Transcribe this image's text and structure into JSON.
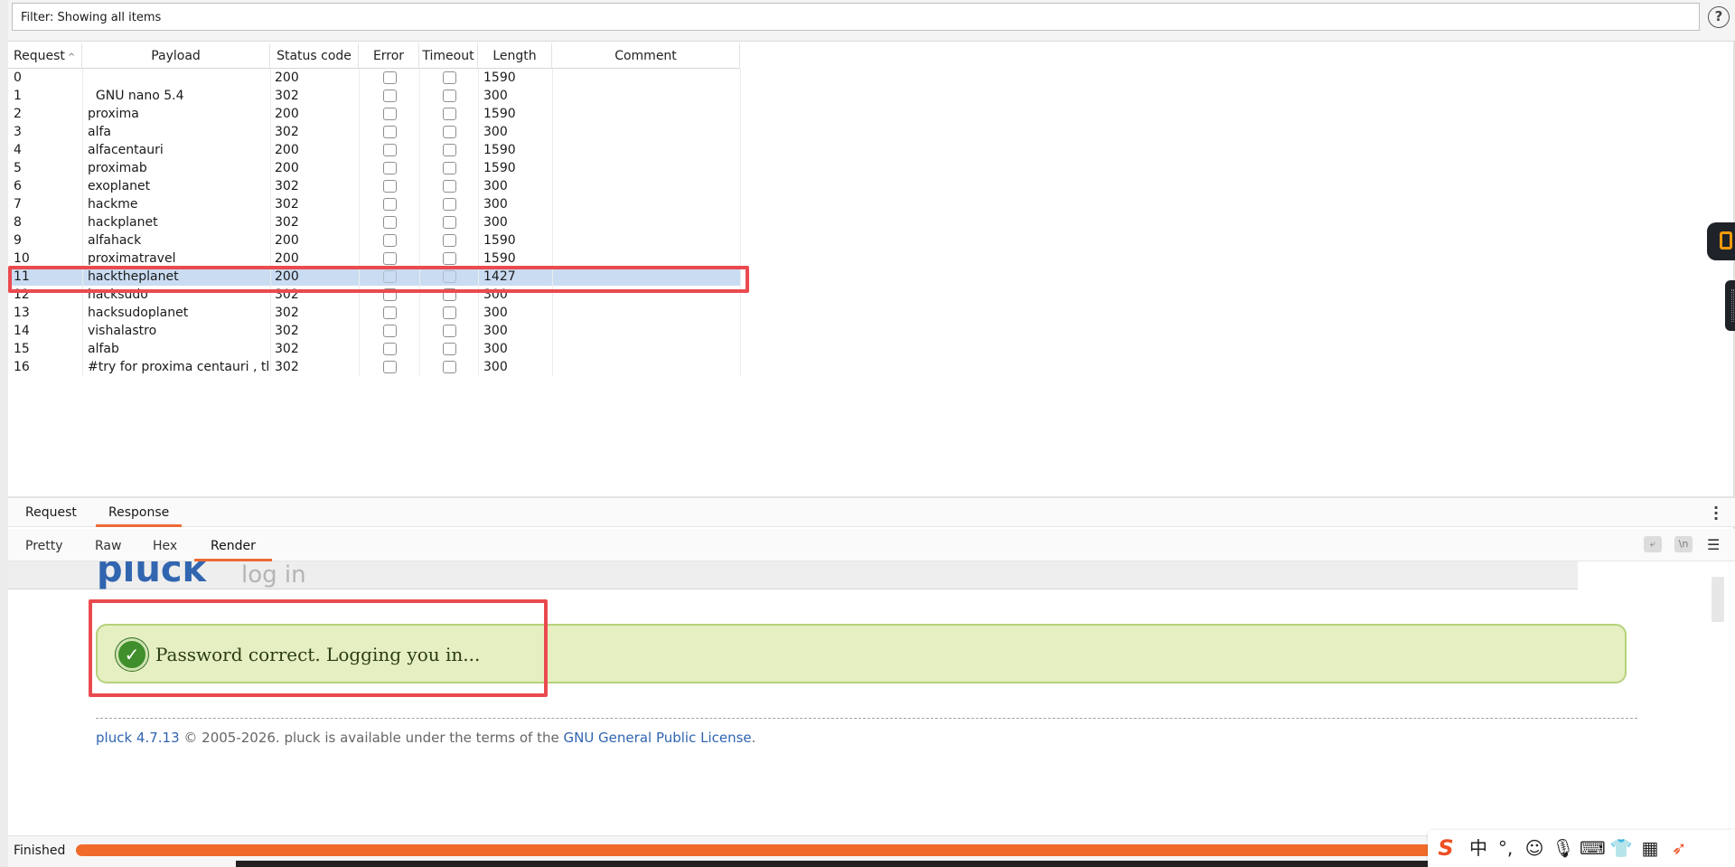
{
  "filter": {
    "text": "Filter: Showing all items",
    "help": "?"
  },
  "table": {
    "headers": {
      "request": "Request",
      "payload": "Payload",
      "status": "Status code",
      "error": "Error",
      "timeout": "Timeout",
      "length": "Length",
      "comment": "Comment"
    },
    "rows": [
      {
        "request": "0",
        "payload": "",
        "status": "200",
        "length": "1590"
      },
      {
        "request": "1",
        "payload": "  GNU nano 5.4",
        "status": "302",
        "length": "300"
      },
      {
        "request": "2",
        "payload": "proxima",
        "status": "200",
        "length": "1590"
      },
      {
        "request": "3",
        "payload": "alfa",
        "status": "302",
        "length": "300"
      },
      {
        "request": "4",
        "payload": "alfacentauri",
        "status": "200",
        "length": "1590"
      },
      {
        "request": "5",
        "payload": "proximab",
        "status": "200",
        "length": "1590"
      },
      {
        "request": "6",
        "payload": "exoplanet",
        "status": "302",
        "length": "300"
      },
      {
        "request": "7",
        "payload": "hackme",
        "status": "302",
        "length": "300"
      },
      {
        "request": "8",
        "payload": "hackplanet",
        "status": "302",
        "length": "300"
      },
      {
        "request": "9",
        "payload": "alfahack",
        "status": "200",
        "length": "1590"
      },
      {
        "request": "10",
        "payload": "proximatravel",
        "status": "200",
        "length": "1590"
      },
      {
        "request": "11",
        "payload": "hacktheplanet",
        "status": "200",
        "length": "1427"
      },
      {
        "request": "12",
        "payload": "hacksudo",
        "status": "302",
        "length": "300"
      },
      {
        "request": "13",
        "payload": "hacksudoplanet",
        "status": "302",
        "length": "300"
      },
      {
        "request": "14",
        "payload": "vishalastro",
        "status": "302",
        "length": "300"
      },
      {
        "request": "15",
        "payload": "alfab",
        "status": "302",
        "length": "300"
      },
      {
        "request": "16",
        "payload": "#try for proxima centauri , th...",
        "status": "302",
        "length": "300"
      }
    ]
  },
  "tabs": {
    "request": "Request",
    "response": "Response"
  },
  "subtabs": {
    "pretty": "Pretty",
    "raw": "Raw",
    "hex": "Hex",
    "render": "Render"
  },
  "render": {
    "logo": "pluck",
    "login": "log in",
    "success": "Password correct. Logging you in...",
    "footer_link1": "pluck 4.7.13",
    "footer_mid": " © 2005-2026. pluck is available under the terms of the ",
    "footer_link2": "GNU General Public License",
    "footer_end": "."
  },
  "status": {
    "text": "Finished"
  },
  "ime": {
    "lang": "中",
    "punct": "°,"
  },
  "colors": {
    "accent": "#ee6a35",
    "highlight": "#ea4a4f",
    "selected_row": "#c9dcf2",
    "success_bg": "#e5efc2",
    "pluck_blue": "#3165b0"
  }
}
